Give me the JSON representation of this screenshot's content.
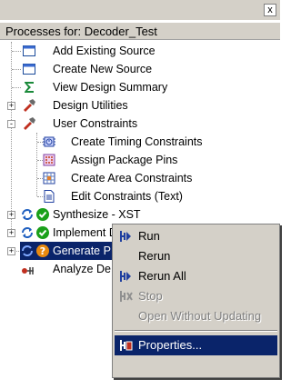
{
  "window": {
    "close_glyph": "x"
  },
  "panel": {
    "header": "Processes for: Decoder_Test"
  },
  "tree": {
    "items": [
      {
        "label": "Add Existing Source"
      },
      {
        "label": "Create New Source"
      },
      {
        "label": "View Design Summary"
      },
      {
        "label": "Design Utilities"
      },
      {
        "label": "User Constraints"
      },
      {
        "label": "Create Timing Constraints"
      },
      {
        "label": "Assign Package Pins"
      },
      {
        "label": "Create Area Constraints"
      },
      {
        "label": "Edit Constraints (Text)"
      },
      {
        "label": "Synthesize - XST"
      },
      {
        "label": "Implement Design"
      },
      {
        "label": "Generate P"
      },
      {
        "label": "Analyze De"
      }
    ],
    "expanders": {
      "plus": "+",
      "minus": "-"
    }
  },
  "context_menu": {
    "items": [
      {
        "label": "Run",
        "icon": "run-icon",
        "enabled": true
      },
      {
        "label": "Rerun",
        "icon": "",
        "enabled": true
      },
      {
        "label": "Rerun All",
        "icon": "rerun-all-icon",
        "enabled": true
      },
      {
        "label": "Stop",
        "icon": "stop-icon",
        "enabled": false
      },
      {
        "label": "Open Without Updating",
        "icon": "",
        "enabled": false
      },
      {
        "label": "Properties...",
        "icon": "properties-icon",
        "enabled": true
      }
    ]
  },
  "colors": {
    "selection": "#0a246a",
    "chrome": "#d4d0c8",
    "success": "#1aa01a",
    "warning": "#e88a10"
  }
}
